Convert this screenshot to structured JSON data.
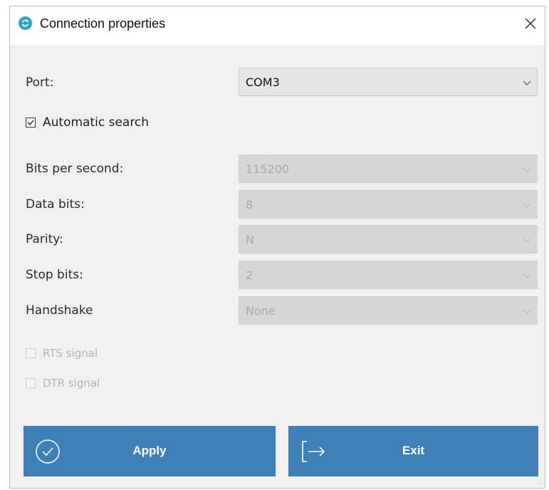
{
  "window": {
    "title": "Connection properties",
    "close_glyph": "✕"
  },
  "form": {
    "port": {
      "label": "Port:",
      "value": "COM3"
    },
    "automatic_search": {
      "label": "Automatic search",
      "checked": true
    },
    "bits_per_second": {
      "label": "Bits per second:",
      "value": "115200"
    },
    "data_bits": {
      "label": "Data bits:",
      "value": "8"
    },
    "parity": {
      "label": "Parity:",
      "value": "N"
    },
    "stop_bits": {
      "label": "Stop bits:",
      "value": "2"
    },
    "handshake": {
      "label": "Handshake",
      "value": "None"
    },
    "rts_signal": {
      "label": "RTS signal",
      "checked": false
    },
    "dtr_signal": {
      "label": "DTR signal",
      "checked": false
    }
  },
  "buttons": {
    "apply": {
      "label": "Apply",
      "icon": "check-circle-icon"
    },
    "exit": {
      "label": "Exit",
      "icon": "exit-arrow-icon"
    }
  },
  "colors": {
    "accent": "#3f7fb7",
    "window_bg": "#f0f0f0",
    "app_icon": "#2fa0c6"
  }
}
